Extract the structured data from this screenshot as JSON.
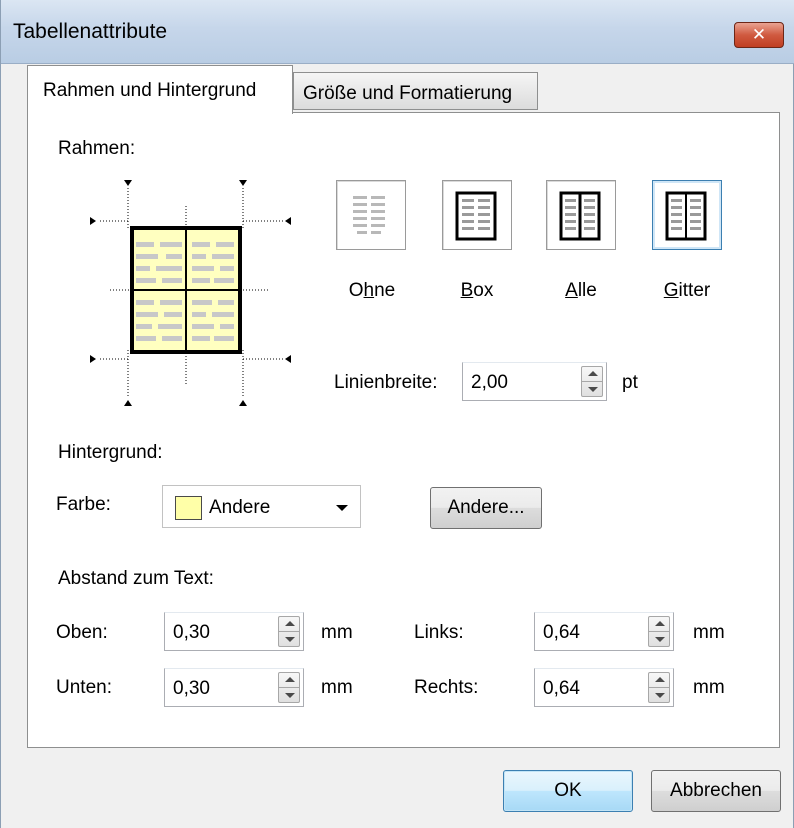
{
  "window": {
    "title": "Tabellenattribute",
    "close_glyph": "✕"
  },
  "tabs": [
    {
      "label": "Rahmen und Hintergrund",
      "active": true
    },
    {
      "label": "Größe und Formatierung",
      "active": false
    }
  ],
  "rahmen": {
    "group_label": "Rahmen:",
    "options": [
      {
        "label": "Ohne",
        "underline_index": 1,
        "selected": false
      },
      {
        "label": "Box",
        "underline_index": 0,
        "selected": false
      },
      {
        "label": "Alle",
        "underline_index": 0,
        "selected": false
      },
      {
        "label": "Gitter",
        "underline_index": 0,
        "selected": true
      }
    ],
    "linienbreite_label": "Linienbreite:",
    "linienbreite_value": "2,00",
    "linienbreite_unit": "pt"
  },
  "hintergrund": {
    "group_label": "Hintergrund:",
    "farbe_label": "Farbe:",
    "farbe_value": "Andere",
    "farbe_color": "#ffffa8",
    "andere_button": "Andere..."
  },
  "abstand": {
    "group_label": "Abstand zum Text:",
    "oben_label": "Oben:",
    "oben_value": "0,30",
    "oben_unit": "mm",
    "unten_label": "Unten:",
    "unten_value": "0,30",
    "unten_unit": "mm",
    "links_label": "Links:",
    "links_value": "0,64",
    "links_unit": "mm",
    "rechts_label": "Rechts:",
    "rechts_value": "0,64",
    "rechts_unit": "mm"
  },
  "buttons": {
    "ok": "OK",
    "cancel": "Abbrechen"
  }
}
